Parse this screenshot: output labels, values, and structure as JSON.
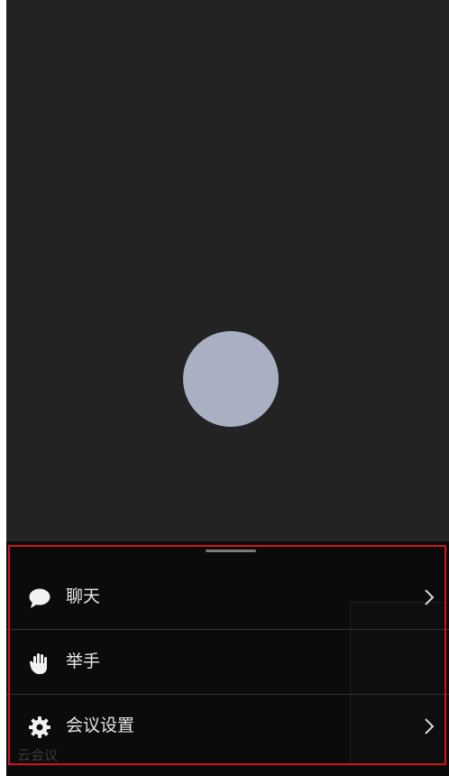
{
  "menu": {
    "items": [
      {
        "label": "聊天",
        "icon": "chat-bubble-icon",
        "has_chevron": true
      },
      {
        "label": "举手",
        "icon": "raise-hand-icon",
        "has_chevron": false
      },
      {
        "label": "会议设置",
        "icon": "gear-icon",
        "has_chevron": true
      }
    ]
  },
  "watermark": "云会议",
  "colors": {
    "background": "#232323",
    "sheet": "#0b0b0c",
    "avatar": "#a9b0c2",
    "text": "#e8e8e8",
    "highlight_border": "#d0161c"
  }
}
